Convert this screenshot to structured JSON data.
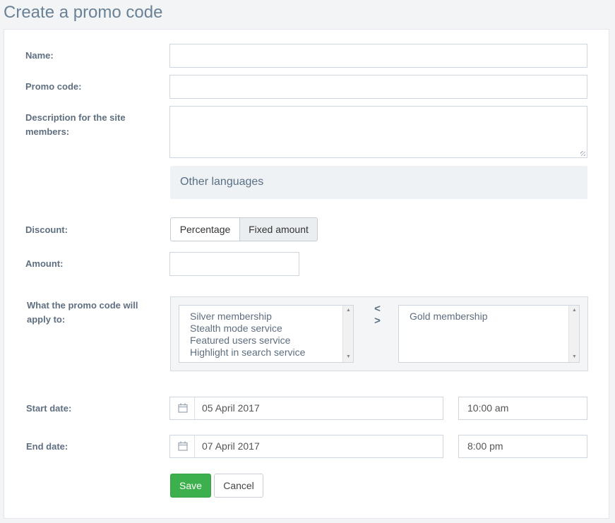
{
  "page": {
    "title": "Create a promo code"
  },
  "form": {
    "name_label": "Name:",
    "name_value": "",
    "promo_code_label": "Promo code:",
    "promo_code_value": "",
    "description_label": "Description for the site members:",
    "description_value": "",
    "other_languages": "Other languages",
    "discount_label": "Discount:",
    "discount_options": [
      "Percentage",
      "Fixed amount"
    ],
    "discount_selected": "Fixed amount",
    "amount_label": "Amount:",
    "amount_value": "",
    "apply_label": "What the promo code will apply to:",
    "available_services": [
      "Silver membership",
      "Stealth mode service",
      "Featured users service",
      "Highlight in search service"
    ],
    "selected_services": [
      "Gold membership"
    ],
    "transfer_icon": "< >",
    "start_date_label": "Start date:",
    "start_date": "05 April 2017",
    "start_time": "10:00 am",
    "end_date_label": "End date:",
    "end_date": "07 April 2017",
    "end_time": "8:00 pm"
  },
  "buttons": {
    "save": "Save",
    "cancel": "Cancel"
  },
  "colors": {
    "save_green": "#3cb04c",
    "title_blue": "#6a8196",
    "panel_bg": "#eef2f5"
  },
  "icons": {
    "calendar": "calendar-icon",
    "transfer": "transfer-arrows-icon",
    "scroll_up": "scroll-up-icon",
    "scroll_down": "scroll-down-icon"
  }
}
